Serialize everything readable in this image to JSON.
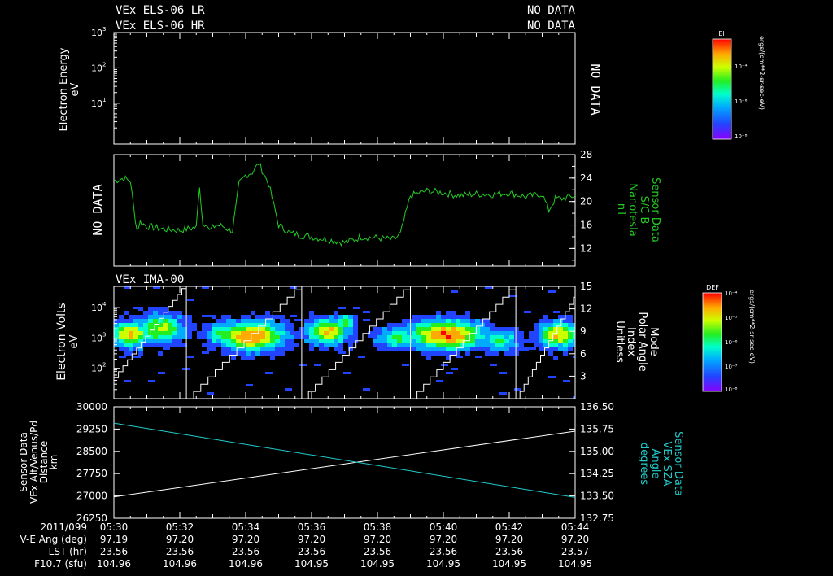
{
  "header": {
    "line1_label": "VEx ELS-06 LR",
    "line1_status": "NO DATA",
    "line2_label": "VEx ELS-06 HR",
    "line2_status": "NO DATA"
  },
  "colorbar_els": {
    "title": "El",
    "ticks": [
      "10⁻⁴",
      "10⁻⁶",
      "10⁻⁸"
    ],
    "unit": "ergs/(cm**2-sr-sec-eV)"
  },
  "colorbar_ima": {
    "title": "DEF",
    "ticks": [
      "10⁻⁴",
      "10⁻⁵",
      "10⁻⁶",
      "10⁻⁷",
      "10⁻⁸"
    ],
    "unit": "ergs/(cm**2-sr-sec-eV)"
  },
  "colors": {
    "green_trace": "#22cc22",
    "cyan_trace": "#22cccc",
    "white_trace": "#ffffff"
  },
  "chart_data": [
    {
      "type": "heatmap",
      "panel": "ELS",
      "ylabel_lines": [
        "Electron Energy",
        "eV"
      ],
      "yscale": "log",
      "yticks": [
        {
          "base": "10",
          "exp": "3"
        },
        {
          "base": "10",
          "exp": "2"
        },
        {
          "base": "10",
          "exp": "1"
        }
      ],
      "ylim": [
        0.7,
        1000
      ],
      "right_note": "NO DATA"
    },
    {
      "type": "line",
      "panel": "MAG",
      "left_note": "NO DATA",
      "ylabel_right_lines": [
        "Sensor Data",
        "S/C B",
        "Nanotesla",
        "nT"
      ],
      "ylim": [
        9,
        28
      ],
      "yticks_right": [
        "28",
        "24",
        "20",
        "16",
        "12"
      ],
      "series": [
        {
          "x_minutes": [
            0,
            0.3,
            0.5,
            0.6,
            0.7,
            0.8,
            1.0,
            1.5,
            2.0,
            2.5,
            2.6,
            2.7,
            2.8,
            2.9,
            3.1,
            3.3,
            3.5,
            3.6,
            3.8,
            4.0,
            4.2,
            4.4,
            4.7,
            5.0,
            5.3,
            5.4,
            5.5,
            5.7,
            6.0,
            6.5,
            7.0,
            7.3,
            7.5,
            8.0,
            8.5,
            8.7,
            9.0,
            9.5,
            10.0,
            10.5,
            11.0,
            11.5,
            12.0,
            12.5,
            13.0,
            13.2,
            13.4,
            13.6,
            14.0
          ],
          "y_nT": [
            23.5,
            24.0,
            23.5,
            19.0,
            15.2,
            16.5,
            15.8,
            15.3,
            15.1,
            15.6,
            22.8,
            16.0,
            16.5,
            15.0,
            16.0,
            15.8,
            15.2,
            15.0,
            23.0,
            24.5,
            25.0,
            26.5,
            23.0,
            16.0,
            14.8,
            14.5,
            14.5,
            14.2,
            14.0,
            13.5,
            13.0,
            13.5,
            14.0,
            13.8,
            13.5,
            14.5,
            21.0,
            21.8,
            21.5,
            21.0,
            21.3,
            21.2,
            21.5,
            20.8,
            21.3,
            18.5,
            20.5,
            20.5,
            21.0
          ]
        }
      ]
    },
    {
      "type": "heatmap",
      "panel": "IMA",
      "title": "VEx IMA-00",
      "ylabel_lines": [
        "Electron Volts",
        "eV"
      ],
      "yscale": "log",
      "yticks": [
        {
          "base": "10",
          "exp": "4"
        },
        {
          "base": "10",
          "exp": "3"
        },
        {
          "base": "10",
          "exp": "2"
        }
      ],
      "ylim": [
        10,
        50000
      ],
      "ylabel_right_lines": [
        "Mode",
        "Polar Angle",
        "Index",
        "Unitless"
      ],
      "yticks_right": [
        "15",
        "12",
        "9",
        "6",
        "3"
      ],
      "ylim_right": [
        0,
        15
      ],
      "blobs": [
        {
          "x_min": 0.5,
          "y_log": 3.1,
          "rx_min": 0.55,
          "ry_log": 0.4,
          "peak": 0.85
        },
        {
          "x_min": 1.4,
          "y_log": 3.3,
          "rx_min": 0.7,
          "ry_log": 0.45,
          "peak": 0.7
        },
        {
          "x_min": 4.2,
          "y_log": 3.05,
          "rx_min": 0.9,
          "ry_log": 0.45,
          "peak": 1.0
        },
        {
          "x_min": 3.3,
          "y_log": 3.1,
          "rx_min": 0.5,
          "ry_log": 0.35,
          "peak": 0.6
        },
        {
          "x_min": 6.5,
          "y_log": 3.2,
          "rx_min": 0.6,
          "ry_log": 0.4,
          "peak": 0.85
        },
        {
          "x_min": 7.0,
          "y_log": 3.5,
          "rx_min": 0.3,
          "ry_log": 0.25,
          "peak": 0.6
        },
        {
          "x_min": 10.1,
          "y_log": 3.1,
          "rx_min": 1.1,
          "ry_log": 0.45,
          "peak": 1.0
        },
        {
          "x_min": 8.7,
          "y_log": 3.0,
          "rx_min": 0.7,
          "ry_log": 0.35,
          "peak": 0.55
        },
        {
          "x_min": 11.7,
          "y_log": 2.9,
          "rx_min": 0.6,
          "ry_log": 0.35,
          "peak": 0.5
        },
        {
          "x_min": 13.5,
          "y_log": 3.1,
          "rx_min": 0.6,
          "ry_log": 0.4,
          "peak": 0.85
        }
      ],
      "mode_resets_minutes": [
        2.2,
        5.7,
        9.0,
        12.2
      ]
    },
    {
      "type": "line",
      "panel": "ORBIT",
      "ylabel_lines": [
        "Sensor Data",
        "VEx Alt/Venus/Pd",
        "Distance",
        "km"
      ],
      "ylabel_right_lines": [
        "Sensor Data",
        "VEx SZA",
        "Angle",
        "degrees"
      ],
      "ylim": [
        26250,
        30000
      ],
      "yticks": [
        "30000",
        "29250",
        "28500",
        "27750",
        "27000",
        "26250"
      ],
      "ylim_right": [
        132.75,
        136.5
      ],
      "yticks_right": [
        "136.50",
        "135.75",
        "135.00",
        "134.25",
        "133.50",
        "132.75"
      ],
      "series": [
        {
          "name": "VEx Alt/Venus/Pd",
          "x_minutes": [
            0,
            14
          ],
          "y": [
            26970,
            29180
          ]
        },
        {
          "name": "VEx SZA",
          "x_minutes": [
            0,
            14
          ],
          "y_right": [
            135.95,
            133.45
          ]
        }
      ]
    }
  ],
  "x_axis": {
    "start": "05:30",
    "end": "05:44",
    "rows": [
      {
        "label": "2011/099",
        "values": [
          "05:30",
          "05:32",
          "05:34",
          "05:36",
          "05:38",
          "05:40",
          "05:42",
          "05:44"
        ]
      },
      {
        "label": "V-E Ang (deg)",
        "values": [
          "97.19",
          "97.20",
          "97.20",
          "97.20",
          "97.20",
          "97.20",
          "97.20",
          "97.20"
        ]
      },
      {
        "label": "LST (hr)",
        "values": [
          "23.56",
          "23.56",
          "23.56",
          "23.56",
          "23.56",
          "23.56",
          "23.56",
          "23.57"
        ]
      },
      {
        "label": "F10.7 (sfu)",
        "values": [
          "104.96",
          "104.96",
          "104.96",
          "104.95",
          "104.95",
          "104.95",
          "104.95",
          "104.95"
        ]
      }
    ]
  }
}
